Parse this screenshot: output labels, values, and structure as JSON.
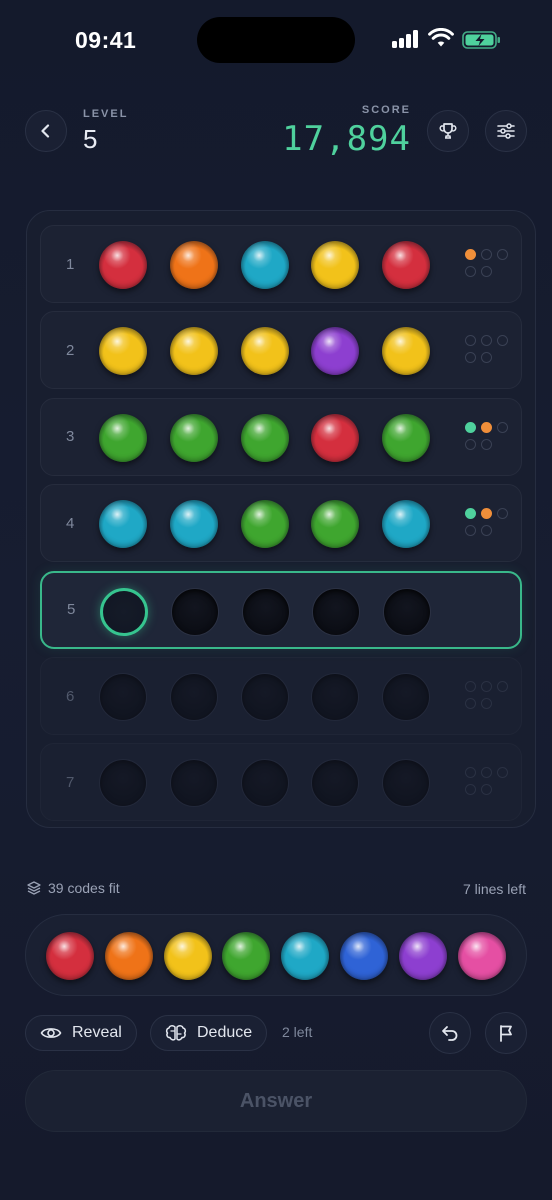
{
  "status": {
    "time": "09:41"
  },
  "header": {
    "level_label": "LEVEL",
    "level_value": "5",
    "score_label": "SCORE",
    "score_value": "17,894",
    "icons": [
      "back-arrow-icon",
      "trophy-icon",
      "sliders-icon"
    ]
  },
  "colors": {
    "red": "#d42f3e",
    "orange": "#ef7318",
    "yellow": "#f2c21a",
    "green": "#3fa62f",
    "cyan": "#1fa8c6",
    "blue": "#2f63d6",
    "purple": "#8d3fd0",
    "pink": "#e54fa3",
    "feedback_exact": "#4fd19d",
    "feedback_color": "#f08f3a",
    "accent": "#36c48f"
  },
  "board": {
    "rows": [
      {
        "number": "1",
        "pegs": [
          "red",
          "orange",
          "cyan",
          "yellow",
          "red"
        ],
        "feedback": {
          "exact": 0,
          "color": 1
        },
        "state": "done"
      },
      {
        "number": "2",
        "pegs": [
          "yellow",
          "yellow",
          "yellow",
          "purple",
          "yellow"
        ],
        "feedback": {
          "exact": 0,
          "color": 0
        },
        "state": "done"
      },
      {
        "number": "3",
        "pegs": [
          "green",
          "green",
          "green",
          "red",
          "green"
        ],
        "feedback": {
          "exact": 1,
          "color": 1
        },
        "state": "done"
      },
      {
        "number": "4",
        "pegs": [
          "cyan",
          "cyan",
          "green",
          "green",
          "cyan"
        ],
        "feedback": {
          "exact": 1,
          "color": 1
        },
        "state": "done"
      },
      {
        "number": "5",
        "pegs": [
          null,
          null,
          null,
          null,
          null
        ],
        "feedback": null,
        "state": "active"
      },
      {
        "number": "6",
        "pegs": [
          null,
          null,
          null,
          null,
          null
        ],
        "feedback": {
          "exact": 0,
          "color": 0
        },
        "state": "pending"
      },
      {
        "number": "7",
        "pegs": [
          null,
          null,
          null,
          null,
          null
        ],
        "feedback": {
          "exact": 0,
          "color": 0
        },
        "state": "pending"
      }
    ]
  },
  "info": {
    "codes_fit": "39 codes fit",
    "lines_left": "7 lines left"
  },
  "palette": [
    "red",
    "orange",
    "yellow",
    "green",
    "cyan",
    "blue",
    "purple",
    "pink"
  ],
  "actions": {
    "reveal_label": "Reveal",
    "deduce_label": "Deduce",
    "hints_left": "2 left",
    "answer_label": "Answer"
  }
}
